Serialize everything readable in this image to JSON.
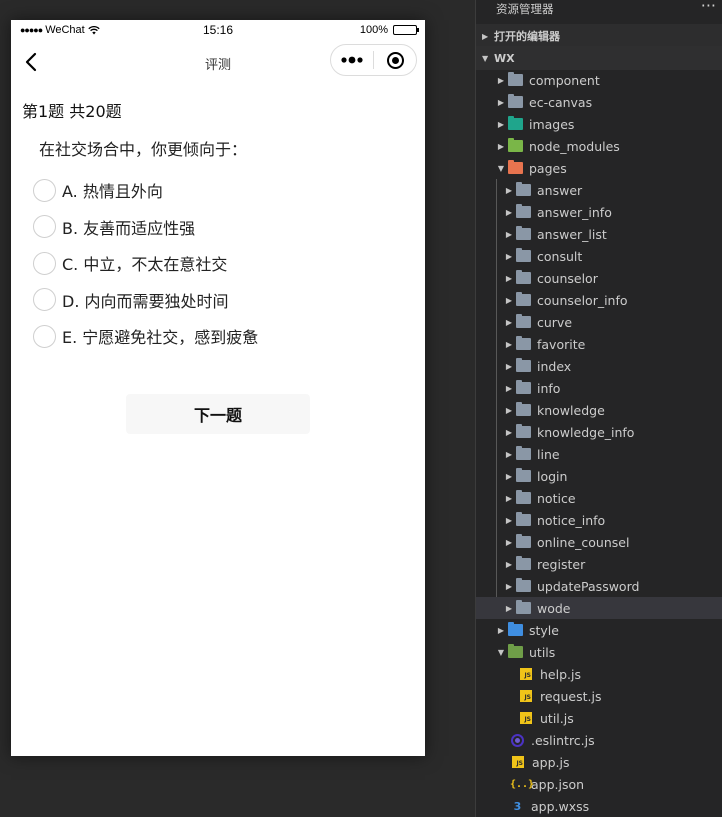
{
  "phone": {
    "status": {
      "carrier": "WeChat",
      "signal_dots": "●●●●●",
      "time": "15:16",
      "battery": "100%",
      "battery_level": 1.0
    },
    "nav": {
      "title": "评测"
    },
    "question": {
      "header": "第1题 共20题",
      "text": "在社交场合中，你更倾向于：",
      "options": [
        "A. 热情且外向",
        "B. 友善而适应性强",
        "C. 中立，不太在意社交",
        "D. 内向而需要独处时间",
        "E. 宁愿避免社交，感到疲惫"
      ],
      "next_label": "下一题"
    }
  },
  "explorer": {
    "title": "资源管理器",
    "more": "···",
    "open_editors": "打开的编辑器",
    "root": "WX",
    "tree": {
      "component": "component",
      "ec_canvas": "ec-canvas",
      "images": "images",
      "node_modules": "node_modules",
      "pages": "pages",
      "pages_children": [
        "answer",
        "answer_info",
        "answer_list",
        "consult",
        "counselor",
        "counselor_info",
        "curve",
        "favorite",
        "index",
        "info",
        "knowledge",
        "knowledge_info",
        "line",
        "login",
        "notice",
        "notice_info",
        "online_counsel",
        "register",
        "updatePassword",
        "wode"
      ],
      "style": "style",
      "utils": "utils",
      "utils_children": [
        "help.js",
        "request.js",
        "util.js"
      ],
      "eslintrc": ".eslintrc.js",
      "app_js": "app.js",
      "app_json": "app.json",
      "app_wxss": "app.wxss"
    },
    "icons": {
      "chevron_right": "▶",
      "chevron_down": "▼",
      "js_badge": "JS",
      "json_badge": "{..}",
      "css_badge": "3"
    }
  }
}
